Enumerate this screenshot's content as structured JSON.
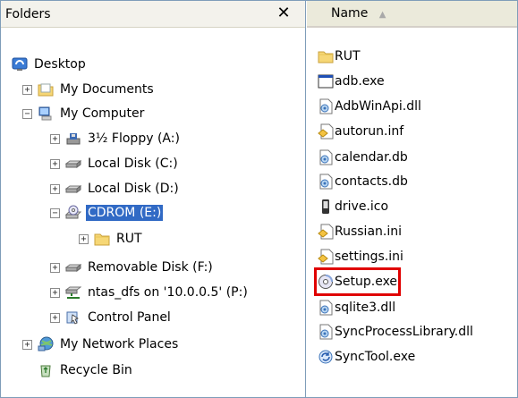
{
  "folders_pane": {
    "title": "Folders",
    "close_glyph": "✕",
    "tree": [
      {
        "label": "Desktop",
        "icon": "desktop-icon",
        "expander": ""
      },
      {
        "label": "My Documents",
        "icon": "my-documents-icon",
        "expander": "+"
      },
      {
        "label": "My Computer",
        "icon": "my-computer-icon",
        "expander": "−"
      },
      {
        "label": "3½ Floppy (A:)",
        "icon": "floppy-icon",
        "expander": "+"
      },
      {
        "label": "Local Disk (C:)",
        "icon": "hard-disk-icon",
        "expander": "+"
      },
      {
        "label": "Local Disk (D:)",
        "icon": "hard-disk-icon",
        "expander": "+"
      },
      {
        "label": "CDROM (E:)",
        "icon": "cdrom-icon",
        "expander": "−",
        "selected": true
      },
      {
        "label": "RUT",
        "icon": "folder-icon",
        "expander": "+"
      },
      {
        "label": "Removable Disk (F:)",
        "icon": "removable-disk-icon",
        "expander": "+"
      },
      {
        "label": "ntas_dfs on '10.0.0.5' (P:)",
        "icon": "network-drive-icon",
        "expander": "+"
      },
      {
        "label": "Control Panel",
        "icon": "control-panel-icon",
        "expander": "+"
      },
      {
        "label": "My Network Places",
        "icon": "network-places-icon",
        "expander": "+"
      },
      {
        "label": "Recycle Bin",
        "icon": "recycle-bin-icon",
        "expander": ""
      }
    ]
  },
  "files_pane": {
    "column_header": "Name",
    "sort_glyph": "▲",
    "files": [
      {
        "label": "RUT",
        "icon": "folder-icon"
      },
      {
        "label": "adb.exe",
        "icon": "exe-window-icon"
      },
      {
        "label": "AdbWinApi.dll",
        "icon": "dll-icon"
      },
      {
        "label": "autorun.inf",
        "icon": "inf-icon"
      },
      {
        "label": "calendar.db",
        "icon": "db-icon"
      },
      {
        "label": "contacts.db",
        "icon": "db-icon"
      },
      {
        "label": "drive.ico",
        "icon": "ico-file-icon"
      },
      {
        "label": "Russian.ini",
        "icon": "ini-icon"
      },
      {
        "label": "settings.ini",
        "icon": "ini-icon"
      },
      {
        "label": "Setup.exe",
        "icon": "setup-disc-icon",
        "highlighted": true
      },
      {
        "label": "sqlite3.dll",
        "icon": "dll-icon"
      },
      {
        "label": "SyncProcessLibrary.dll",
        "icon": "dll-icon"
      },
      {
        "label": "SyncTool.exe",
        "icon": "sync-icon"
      }
    ]
  },
  "colors": {
    "selection": "#316ac5",
    "highlight_box": "#e00000",
    "border": "#7f9db9"
  }
}
